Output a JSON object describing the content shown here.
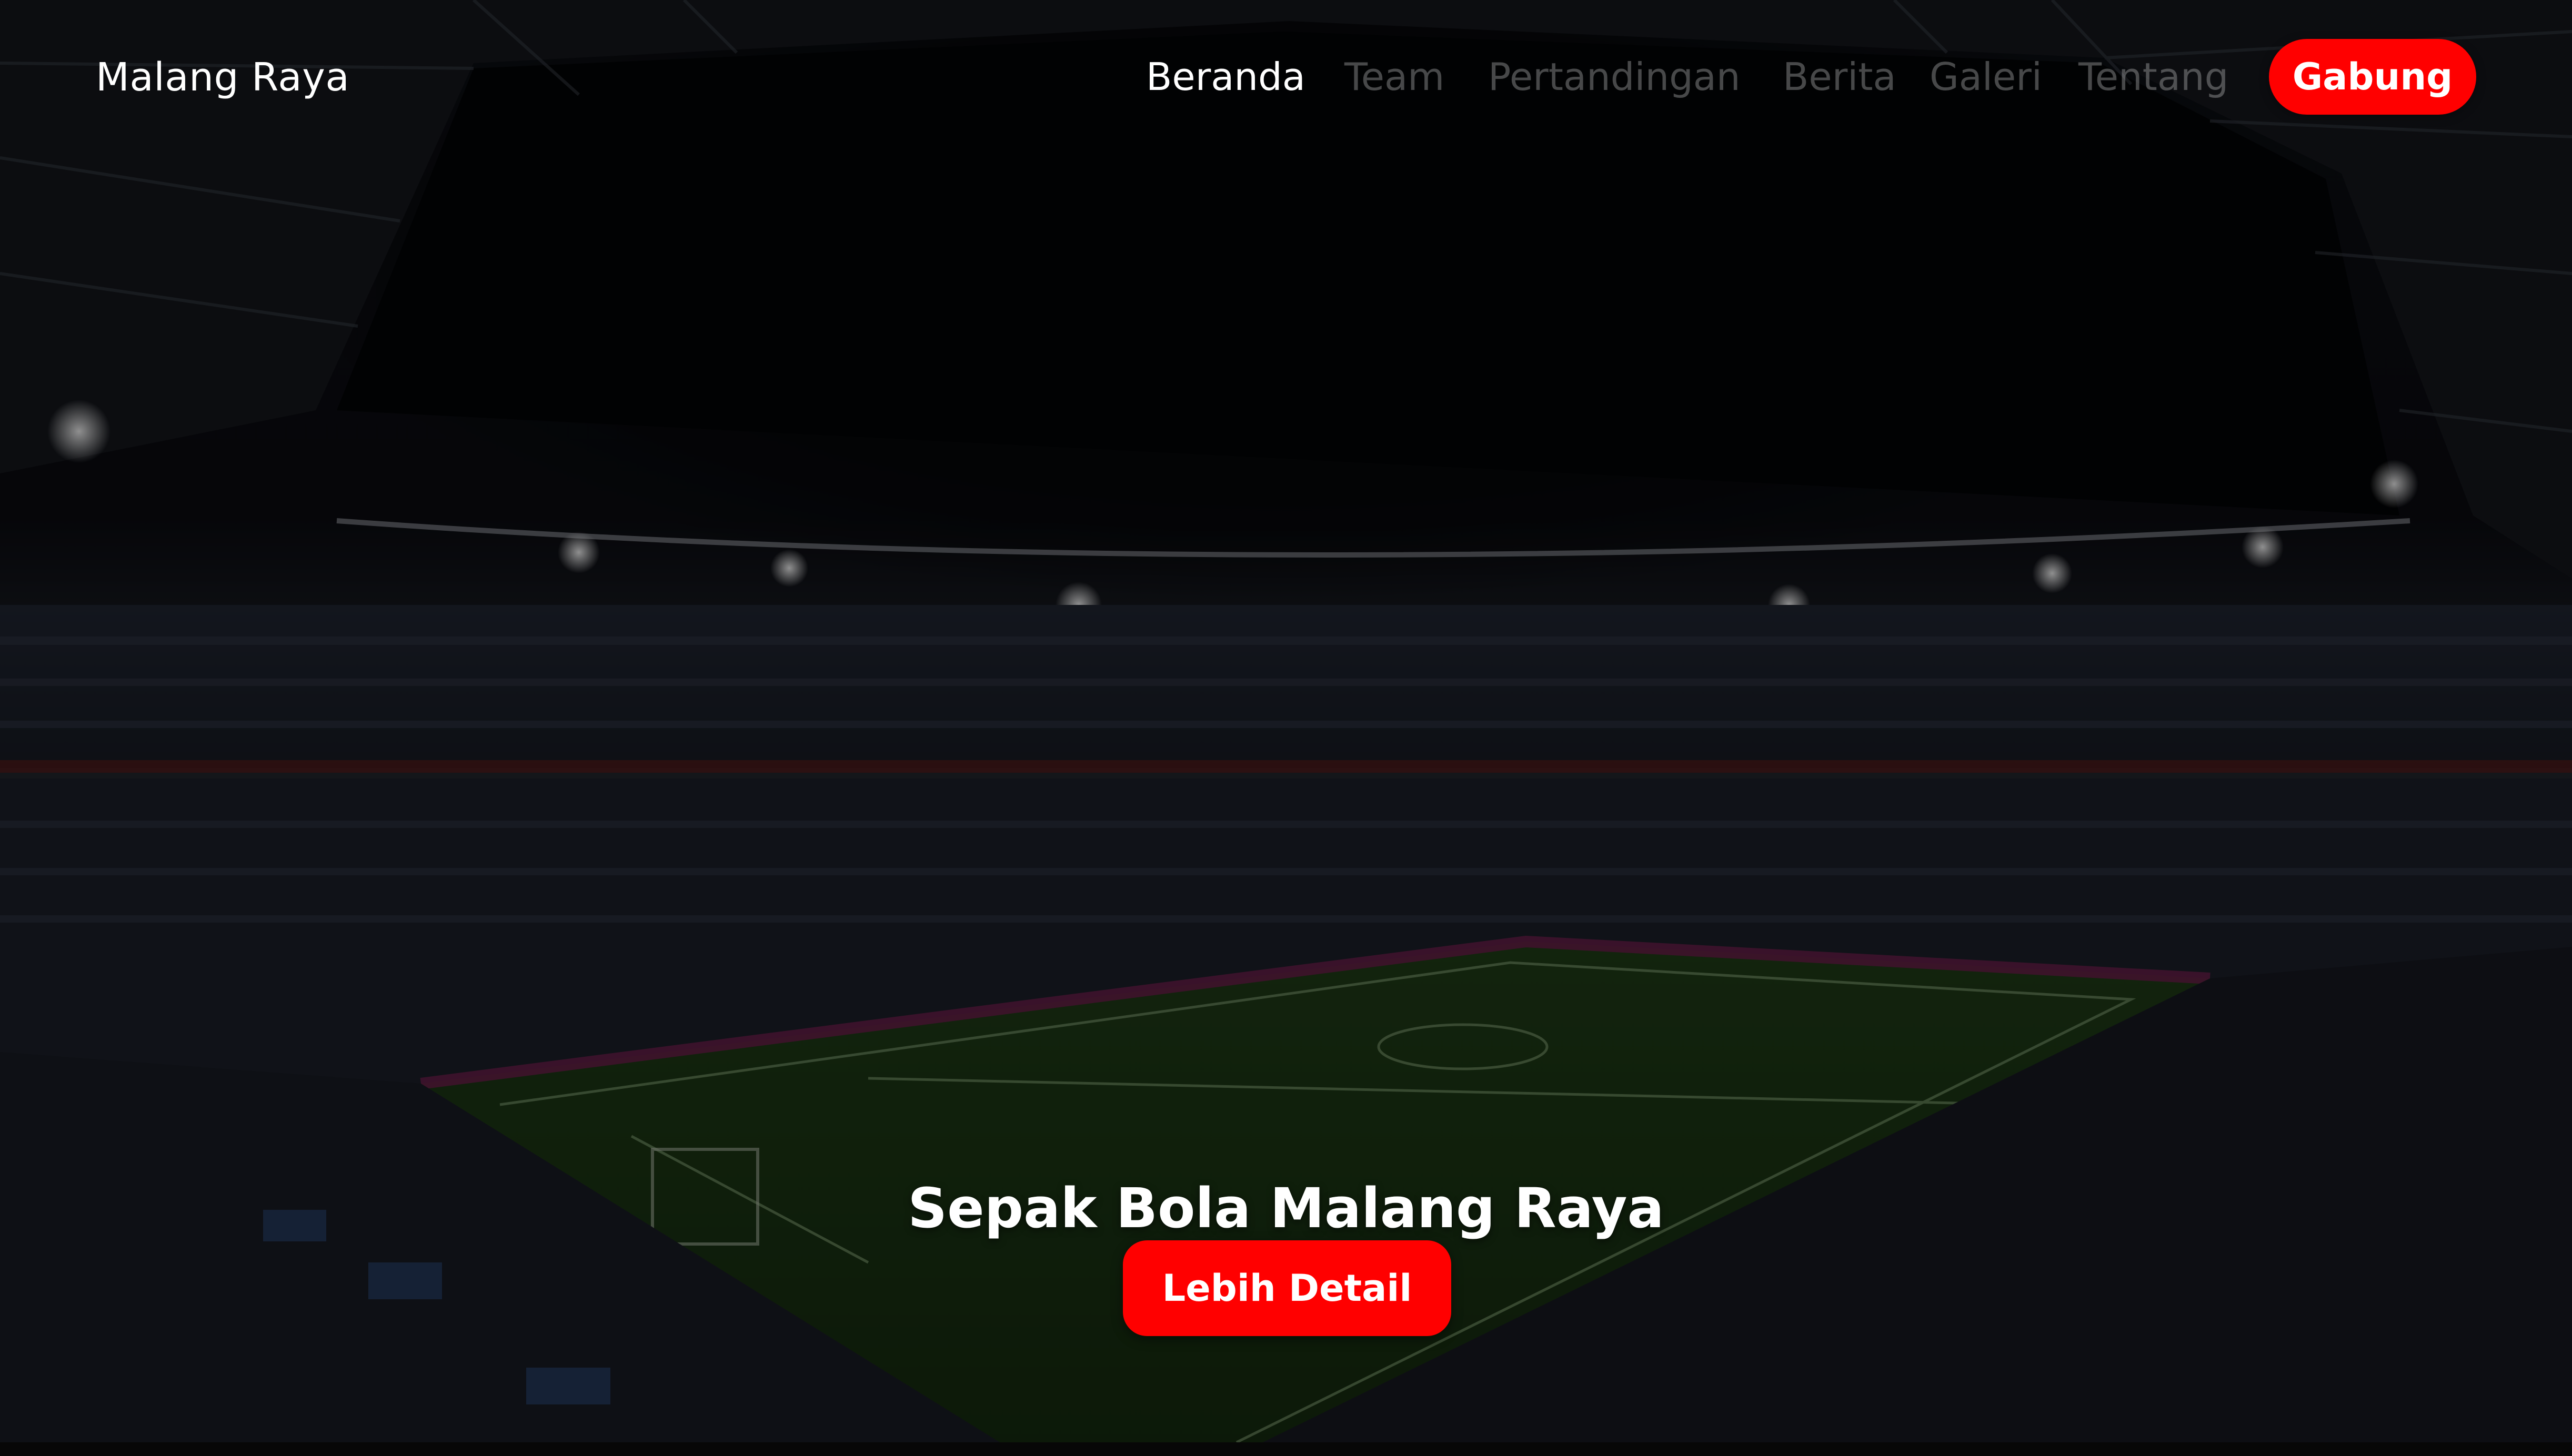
{
  "navbar": {
    "brand": "Malang Raya",
    "menu": [
      {
        "label": "Beranda",
        "active": true
      },
      {
        "label": "Team",
        "active": false
      },
      {
        "label": "Pertandingan",
        "active": false
      },
      {
        "label": "Berita",
        "active": false
      },
      {
        "label": "Galeri",
        "active": false
      },
      {
        "label": "Tentang",
        "active": false
      }
    ],
    "join_label": "Gabung"
  },
  "hero": {
    "title": "Sepak Bola Malang Raya",
    "cta_label": "Lebih Detail",
    "background": "stadium-night-photo"
  },
  "colors": {
    "accent": "#ff0000",
    "text": "#ffffff",
    "inactive_menu": "#5a5a5a"
  }
}
